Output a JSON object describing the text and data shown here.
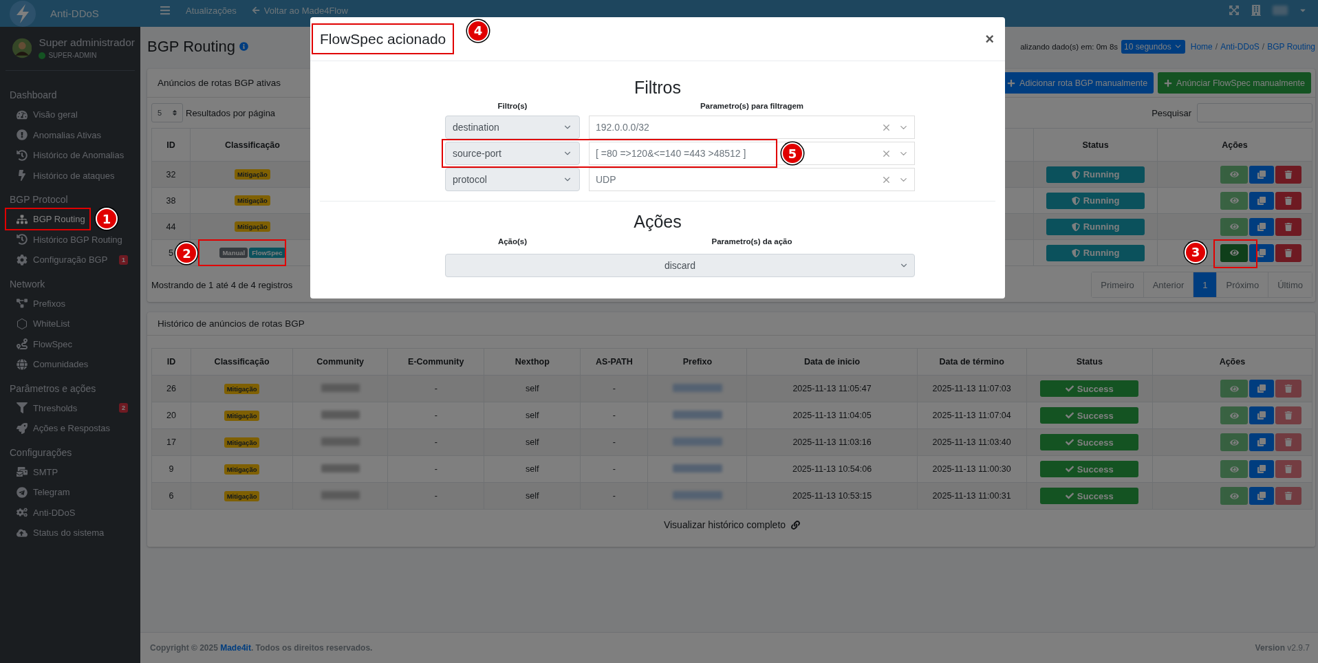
{
  "topbar": {
    "brand": "Anti-DDoS",
    "links": [
      {
        "label": "Atualizações",
        "kind": "plain"
      },
      {
        "label": "Voltar ao Made4Flow",
        "kind": "back"
      }
    ]
  },
  "sidebar": {
    "user": {
      "name": "Super administrador",
      "role": "SUPER-ADMIN",
      "online": true
    },
    "sections": [
      {
        "title": "Dashboard",
        "items": [
          {
            "label": "Visão geral",
            "selected": false
          },
          {
            "label": "Anomalias Ativas",
            "selected": false
          },
          {
            "label": "Histórico de Anomalias",
            "selected": false
          },
          {
            "label": "Histórico de ataques",
            "selected": false
          }
        ]
      },
      {
        "title": "BGP Protocol",
        "items": [
          {
            "label": "BGP Routing",
            "selected": true,
            "callout": "1"
          },
          {
            "label": "Histórico BGP Routing",
            "selected": false
          },
          {
            "label": "Configuração BGP",
            "selected": false,
            "badge": "1"
          }
        ]
      },
      {
        "title": "Network",
        "items": [
          {
            "label": "Prefixos",
            "selected": false
          },
          {
            "label": "WhiteList",
            "selected": false
          },
          {
            "label": "FlowSpec",
            "selected": false
          },
          {
            "label": "Comunidades",
            "selected": false
          }
        ]
      },
      {
        "title": "Parâmetros e ações",
        "items": [
          {
            "label": "Thresholds",
            "selected": false,
            "badge": "2"
          },
          {
            "label": "Ações e Respostas",
            "selected": false
          }
        ]
      },
      {
        "title": "Configurações",
        "items": [
          {
            "label": "SMTP",
            "selected": false
          },
          {
            "label": "Telegram",
            "selected": false
          },
          {
            "label": "Anti-DDoS",
            "selected": false
          },
          {
            "label": "Status do sistema",
            "selected": false
          }
        ]
      }
    ]
  },
  "header": {
    "title": "BGP Routing",
    "refresh_text": "alizando dado(s) em: 0m 8s",
    "refresh_select": "10 segundos",
    "breadcrumb_separator": "/",
    "breadcrumb": [
      "Home",
      "Anti-DDoS",
      "BGP Routing"
    ]
  },
  "active_routes": {
    "title": "Anúncios de rotas BGP ativas",
    "buttons": [
      {
        "label": "Adicionar rota BGP manualmente",
        "kind": "primary"
      },
      {
        "label": "Anúnciar FlowSpec manualmente",
        "kind": "success"
      }
    ],
    "page_length": "5",
    "page_length_label": "Resultados por página",
    "search_label": "Pesquisar",
    "columns_left": [
      "ID",
      "Classificação"
    ],
    "columns_right": [
      "Status",
      "Ações"
    ],
    "rows": [
      {
        "id": "32",
        "tags": [
          {
            "label": "Mitigação",
            "kind": "warning"
          }
        ],
        "status": {
          "label": "Running",
          "kind": "running"
        },
        "view_disabled": true,
        "delete_disabled": false
      },
      {
        "id": "38",
        "tags": [
          {
            "label": "Mitigação",
            "kind": "warning"
          }
        ],
        "status": {
          "label": "Running",
          "kind": "running"
        },
        "view_disabled": true,
        "delete_disabled": false
      },
      {
        "id": "44",
        "tags": [
          {
            "label": "Mitigação",
            "kind": "warning"
          }
        ],
        "status": {
          "label": "Running",
          "kind": "running"
        },
        "view_disabled": true,
        "delete_disabled": false
      },
      {
        "id": "5",
        "tags": [
          {
            "label": "Manual",
            "kind": "secondary"
          },
          {
            "label": "FlowSpec",
            "kind": "info"
          }
        ],
        "status": {
          "label": "Running",
          "kind": "running"
        },
        "view_disabled": false,
        "delete_disabled": false,
        "tags_callout": "2",
        "view_callout": "3"
      }
    ],
    "info": "Mostrando de 1 até 4 de 4 registros",
    "pagination": [
      {
        "label": "Primeiro",
        "selected": false
      },
      {
        "label": "Anterior",
        "selected": false
      },
      {
        "label": "1",
        "selected": true
      },
      {
        "label": "Próximo",
        "selected": false
      },
      {
        "label": "Último",
        "selected": false
      }
    ]
  },
  "history": {
    "title": "Histórico de anúncios de rotas BGP",
    "columns": [
      "ID",
      "Classificação",
      "Community",
      "E-Community",
      "Nexthop",
      "AS-PATH",
      "Prefixo",
      "Data de inicio",
      "Data de término",
      "Status",
      "Ações"
    ],
    "rows": [
      {
        "id": "26",
        "tag": {
          "label": "Mitigação",
          "kind": "warning"
        },
        "e_community": "-",
        "nexthop": "self",
        "as_path": "-",
        "start": "2025-11-13 11:05:47",
        "end": "2025-11-13 11:07:03",
        "status": {
          "label": "Success",
          "kind": "success"
        },
        "view_disabled": true,
        "delete_disabled": true
      },
      {
        "id": "20",
        "tag": {
          "label": "Mitigação",
          "kind": "warning"
        },
        "e_community": "-",
        "nexthop": "self",
        "as_path": "-",
        "start": "2025-11-13 11:04:05",
        "end": "2025-11-13 11:07:04",
        "status": {
          "label": "Success",
          "kind": "success"
        },
        "view_disabled": true,
        "delete_disabled": true
      },
      {
        "id": "17",
        "tag": {
          "label": "Mitigação",
          "kind": "warning"
        },
        "e_community": "-",
        "nexthop": "self",
        "as_path": "-",
        "start": "2025-11-13 11:03:16",
        "end": "2025-11-13 11:03:40",
        "status": {
          "label": "Success",
          "kind": "success"
        },
        "view_disabled": true,
        "delete_disabled": true
      },
      {
        "id": "9",
        "tag": {
          "label": "Mitigação",
          "kind": "warning"
        },
        "e_community": "-",
        "nexthop": "self",
        "as_path": "-",
        "start": "2025-11-13 10:54:06",
        "end": "2025-11-13 11:00:30",
        "status": {
          "label": "Success",
          "kind": "success"
        },
        "view_disabled": true,
        "delete_disabled": true
      },
      {
        "id": "6",
        "tag": {
          "label": "Mitigação",
          "kind": "warning"
        },
        "e_community": "-",
        "nexthop": "self",
        "as_path": "-",
        "start": "2025-11-13 10:53:15",
        "end": "2025-11-13 11:00:31",
        "status": {
          "label": "Success",
          "kind": "success"
        },
        "view_disabled": true,
        "delete_disabled": true
      }
    ],
    "link": "Visualizar histórico completo"
  },
  "footer": {
    "copyright_before": "Copyright © 2025 ",
    "copyright_link": "Made4it",
    "copyright_after": ". Todos os direitos reservados.",
    "version": "**Version** v2.9.7"
  },
  "modal": {
    "title": "FlowSpec acionado",
    "title_callout": "4",
    "close": "×",
    "filters_title": "Filtros",
    "filter_columns": [
      "Filtro(s)",
      "Parametro(s) para filtragem"
    ],
    "filters": [
      {
        "filter": "destination",
        "value": "192.0.0.0/32"
      },
      {
        "filter": "source-port",
        "value": "[ =80 =>120&<=140 =443 >48512 ]",
        "callout": "5"
      },
      {
        "filter": "protocol",
        "value": "UDP"
      }
    ],
    "actions_title": "Ações",
    "action_columns": [
      "Ação(s)",
      "Parametro(s) da ação"
    ],
    "action": "discard"
  }
}
